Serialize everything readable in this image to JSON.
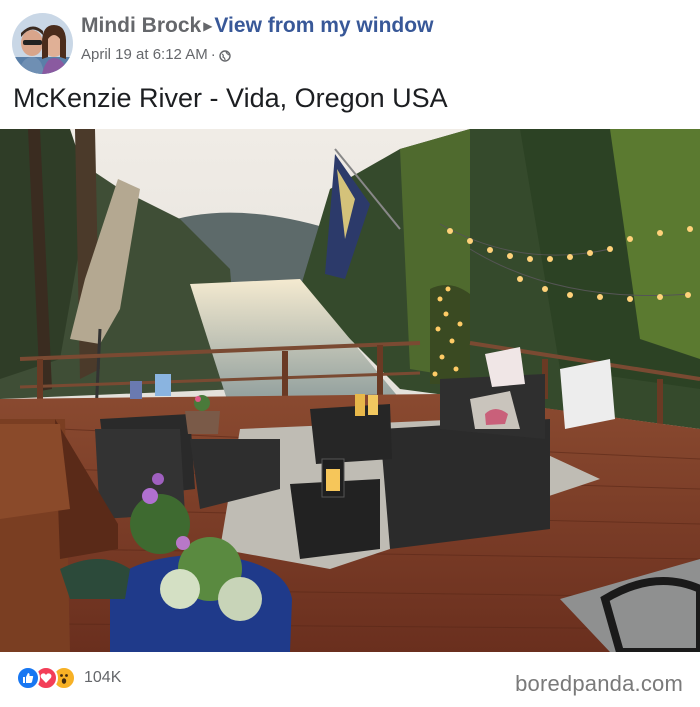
{
  "post": {
    "author": "Mindi Brock",
    "group": "View from my window",
    "date": "April 19 at 6:12 AM",
    "separator": "·",
    "privacy_icon": "globe-icon",
    "text": "McKenzie River - Vida, Oregon USA"
  },
  "photo": {
    "content": "deck-river-view-photo"
  },
  "footer": {
    "reactions": [
      "like-icon",
      "love-icon",
      "wow-icon"
    ],
    "reaction_count": "104K",
    "watermark": "boredpanda.com"
  },
  "colors": {
    "link": "#385898",
    "meta": "#65676b",
    "like": "#1877f2",
    "love": "#f33e58",
    "wow": "#f7b125"
  }
}
